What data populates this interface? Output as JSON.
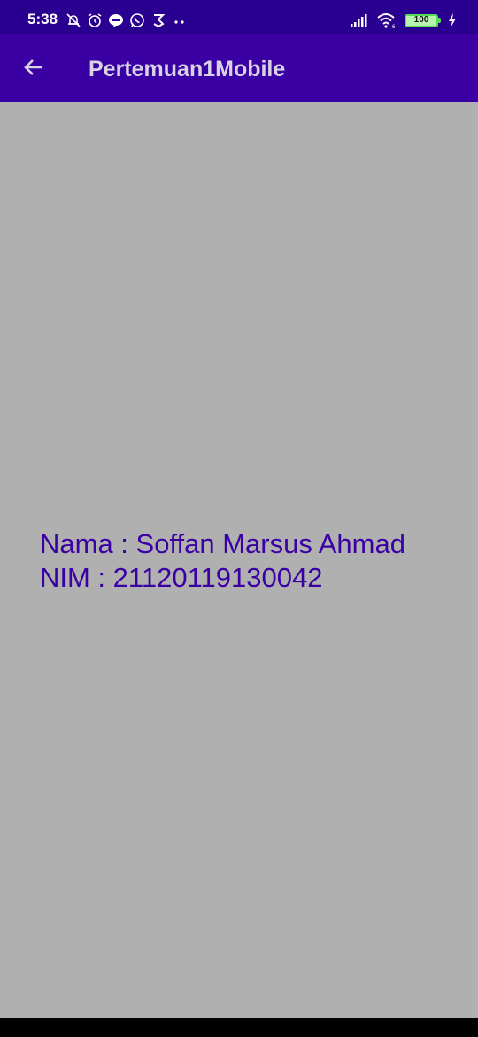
{
  "status_bar": {
    "time": "5:38",
    "battery_level": "100",
    "left_icons": [
      "bell-off-icon",
      "alarm-icon",
      "line-icon",
      "whatsapp-icon",
      "vpn-icon",
      "more-dots-icon"
    ],
    "right_icons": [
      "signal-icon",
      "wifi-icon",
      "battery-icon",
      "charging-icon"
    ],
    "background_color": "#2a0090"
  },
  "app_bar": {
    "title": "Pertemuan1Mobile",
    "back_icon": "arrow-left-icon",
    "background_color": "#3b00a4"
  },
  "content": {
    "name_line": "Nama : Soffan Marsus Ahmad",
    "nim_line": "NIM : 21120119130042",
    "text_color": "#3b00a4",
    "background_color": "#b0b0b0"
  }
}
